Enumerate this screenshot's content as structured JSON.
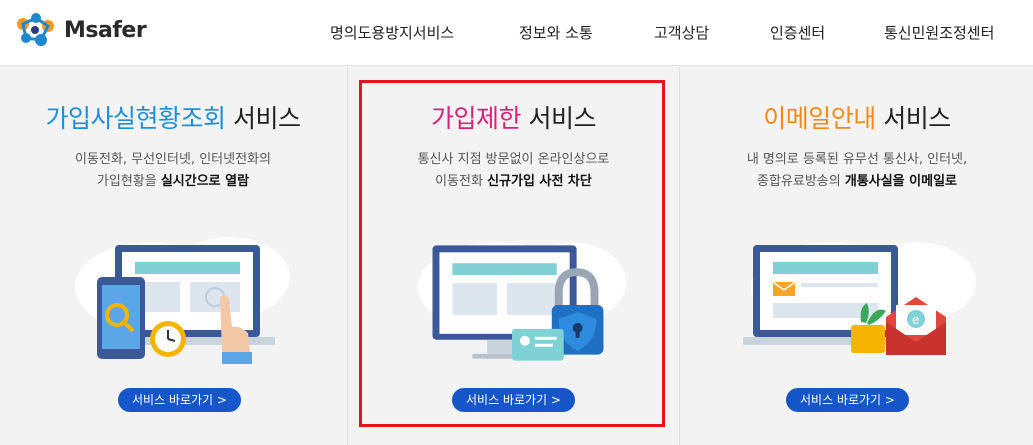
{
  "header": {
    "logo_text": "Msafer",
    "nav": [
      "명의도용방지서비스",
      "정보와 소통",
      "고객상담",
      "인증센터",
      "통신민원조정센터"
    ]
  },
  "cards": [
    {
      "title_highlight": "가입사실현황조회",
      "title_rest": " 서비스",
      "highlight_color": "#1e8fd8",
      "desc_line1": "이동전화, 무선인터넷, 인터넷전화의",
      "desc_line2_pre": "가입현황을 ",
      "desc_line2_bold": "실시간으로 열람",
      "button": "서비스 바로가기 >"
    },
    {
      "title_highlight": "가입제한",
      "title_rest": " 서비스",
      "highlight_color": "#d8227a",
      "desc_line1": "통신사 지점 방문없이 온라인상으로",
      "desc_line2_pre": "이동전화 ",
      "desc_line2_bold": "신규가입 사전 차단",
      "button": "서비스 바로가기 >"
    },
    {
      "title_highlight": "이메일안내",
      "title_rest": " 서비스",
      "highlight_color": "#f08a1c",
      "desc_line1": "내 명의로 등록된 유무선 통신사, 인터넷,",
      "desc_line2_pre": "종합유료방송의 ",
      "desc_line2_bold": "개통사실을 이메일로",
      "button": "서비스 바로가기 >"
    }
  ]
}
